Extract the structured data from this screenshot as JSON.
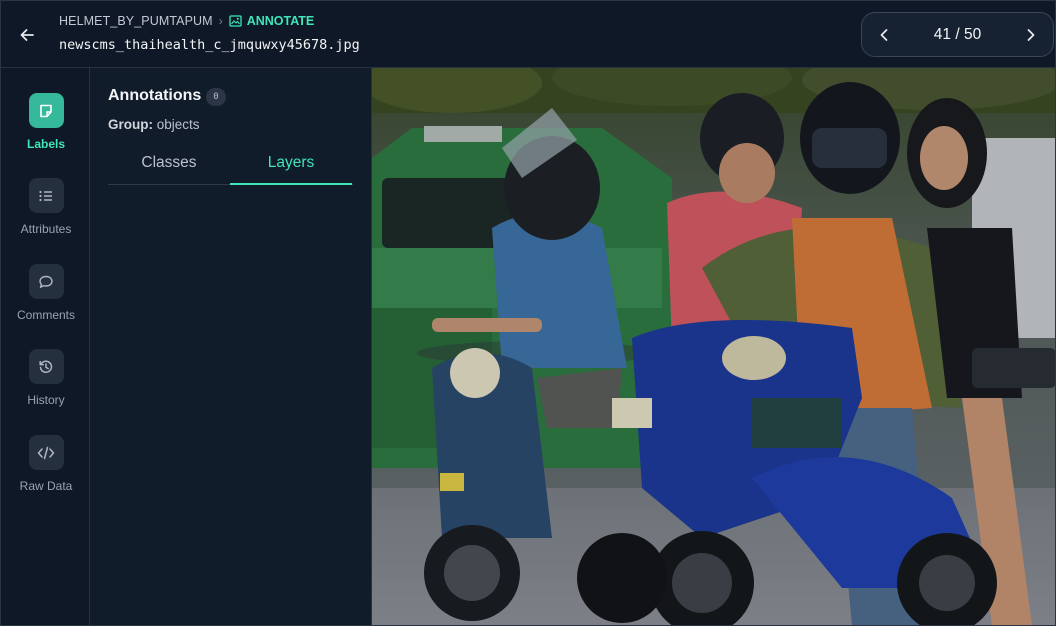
{
  "header": {
    "project": "HELMET_BY_PUMTAPUM",
    "breadcrumb_sep": "›",
    "mode": "ANNOTATE",
    "filename": "newscms_thaihealth_c_jmquwxy45678.jpg",
    "pager_text": "41 / 50"
  },
  "rail": {
    "items": [
      {
        "label": "Labels",
        "icon": "tag-icon",
        "active": true
      },
      {
        "label": "Attributes",
        "icon": "list-icon",
        "active": false
      },
      {
        "label": "Comments",
        "icon": "comment-icon",
        "active": false
      },
      {
        "label": "History",
        "icon": "history-icon",
        "active": false
      },
      {
        "label": "Raw Data",
        "icon": "code-icon",
        "active": false
      }
    ]
  },
  "panel": {
    "title": "Annotations",
    "count": "0",
    "group_label": "Group:",
    "group_value": "objects",
    "tabs": [
      {
        "label": "Classes",
        "active": false
      },
      {
        "label": "Layers",
        "active": true
      }
    ]
  },
  "colors": {
    "accent": "#3ee6b8",
    "background": "#0f1826",
    "panel": "#111c2b"
  }
}
